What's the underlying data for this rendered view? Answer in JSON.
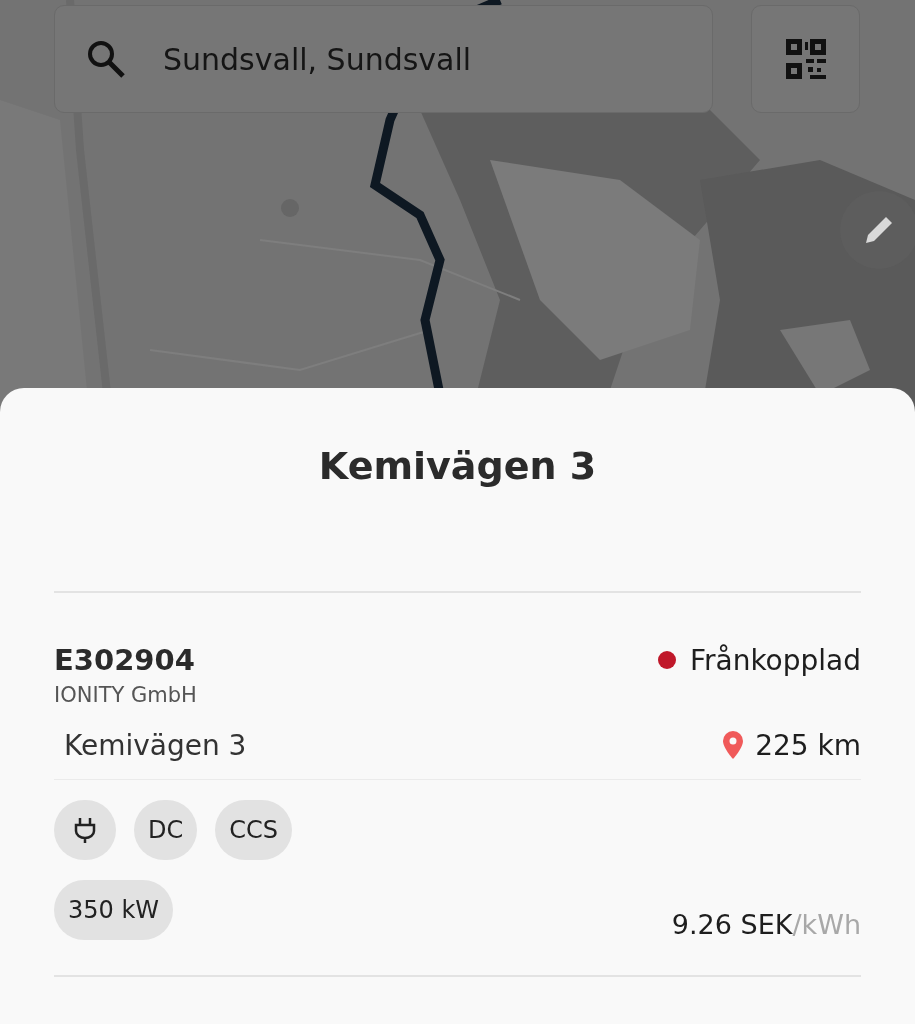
{
  "search": {
    "value": "Sundsvall, Sundsvall"
  },
  "station_sheet": {
    "title": "Kemivägen 3",
    "charger": {
      "id": "E302904",
      "operator": "IONITY GmbH",
      "status": {
        "label": "Frånkopplad",
        "color": "#c0182a"
      },
      "address": "Kemivägen 3",
      "distance": "225 km",
      "tags": [
        {
          "kind": "plug"
        },
        {
          "kind": "text",
          "label": "DC"
        },
        {
          "kind": "text",
          "label": "CCS"
        }
      ],
      "power": "350 kW",
      "price": "9.26 SEK",
      "price_unit": "/kWh"
    }
  }
}
